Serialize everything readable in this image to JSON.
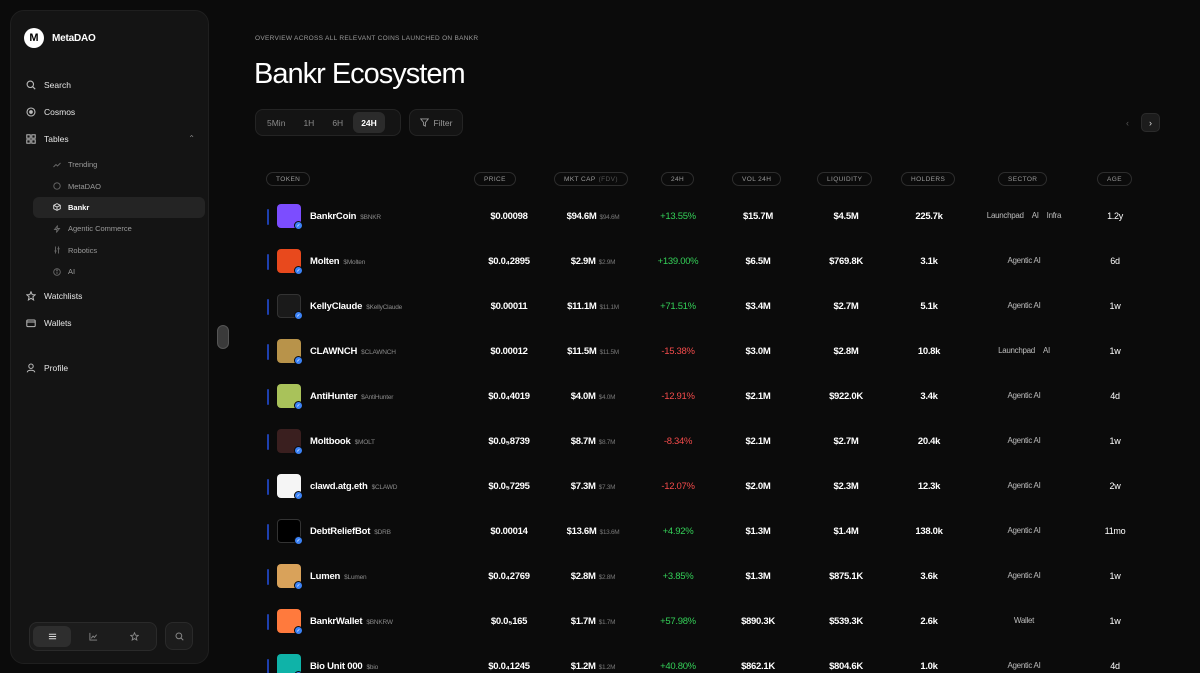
{
  "brand": {
    "logo_letter": "M",
    "name": "MetaDAO"
  },
  "nav": {
    "search": "Search",
    "cosmos": "Cosmos",
    "tables": "Tables",
    "sub": [
      "Trending",
      "MetaDAO",
      "Bankr",
      "Agentic Commerce",
      "Robotics",
      "AI"
    ],
    "watchlists": "Watchlists",
    "wallets": "Wallets",
    "profile": "Profile"
  },
  "page": {
    "eyebrow": "OVERVIEW ACROSS ALL RELEVANT COINS LAUNCHED ON BANKR",
    "title": "Bankr Ecosystem"
  },
  "timeframes": [
    "5Min",
    "1H",
    "6H",
    "24H"
  ],
  "active_timeframe": "24H",
  "filter_label": "Filter",
  "pager": {
    "prev": "‹",
    "next": "›"
  },
  "headers": {
    "token": "TOKEN",
    "price": "PRICE",
    "mcap": "MKT CAP",
    "mcap_sub": "(FDV)",
    "change": "24H",
    "vol": "VOL 24H",
    "liquidity": "LIQUIDITY",
    "holders": "HOLDERS",
    "sector": "SECTOR",
    "age": "AGE"
  },
  "rows": [
    {
      "name": "BankrCoin",
      "symbol": "$BNKR",
      "price": "$0.00098",
      "mcap": "$94.6M",
      "fdv": "$94.6M",
      "change": "+13.55%",
      "dir": "up",
      "vol": "$15.7M",
      "liq": "$4.5M",
      "holders": "225.7k",
      "sector": [
        "Launchpad",
        "AI",
        "Infra"
      ],
      "age": "1.2y",
      "logo_color": "#7c4dff"
    },
    {
      "name": "Molten",
      "symbol": "$Molten",
      "price": "$0.0₄2895",
      "mcap": "$2.9M",
      "fdv": "$2.9M",
      "change": "+139.00%",
      "dir": "up",
      "vol": "$6.5M",
      "liq": "$769.8K",
      "holders": "3.1k",
      "sector": [
        "Agentic AI"
      ],
      "age": "6d",
      "logo_color": "#e8491d"
    },
    {
      "name": "KellyClaude",
      "symbol": "$KellyClaude",
      "price": "$0.00011",
      "mcap": "$11.1M",
      "fdv": "$11.1M",
      "change": "+71.51%",
      "dir": "up",
      "vol": "$3.4M",
      "liq": "$2.7M",
      "holders": "5.1k",
      "sector": [
        "Agentic AI"
      ],
      "age": "1w",
      "logo_color": "#1a1a1a"
    },
    {
      "name": "CLAWNCH",
      "symbol": "$CLAWNCH",
      "price": "$0.00012",
      "mcap": "$11.5M",
      "fdv": "$11.5M",
      "change": "-15.38%",
      "dir": "down",
      "vol": "$3.0M",
      "liq": "$2.8M",
      "holders": "10.8k",
      "sector": [
        "Launchpad",
        "AI"
      ],
      "age": "1w",
      "logo_color": "#b8934a"
    },
    {
      "name": "AntiHunter",
      "symbol": "$AntiHunter",
      "price": "$0.0₄4019",
      "mcap": "$4.0M",
      "fdv": "$4.0M",
      "change": "-12.91%",
      "dir": "down",
      "vol": "$2.1M",
      "liq": "$922.0K",
      "holders": "3.4k",
      "sector": [
        "Agentic AI"
      ],
      "age": "4d",
      "logo_color": "#a9c25a"
    },
    {
      "name": "Moltbook",
      "symbol": "$MOLT",
      "price": "$0.0₅8739",
      "mcap": "$8.7M",
      "fdv": "$8.7M",
      "change": "-8.34%",
      "dir": "down",
      "vol": "$2.1M",
      "liq": "$2.7M",
      "holders": "20.4k",
      "sector": [
        "Agentic AI"
      ],
      "age": "1w",
      "logo_color": "#3a1f1f"
    },
    {
      "name": "clawd.atg.eth",
      "symbol": "$CLAWD",
      "price": "$0.0₅7295",
      "mcap": "$7.3M",
      "fdv": "$7.3M",
      "change": "-12.07%",
      "dir": "down",
      "vol": "$2.0M",
      "liq": "$2.3M",
      "holders": "12.3k",
      "sector": [
        "Agentic AI"
      ],
      "age": "2w",
      "logo_color": "#f5f5f5"
    },
    {
      "name": "DebtReliefBot",
      "symbol": "$DRB",
      "price": "$0.00014",
      "mcap": "$13.6M",
      "fdv": "$13.6M",
      "change": "+4.92%",
      "dir": "up",
      "vol": "$1.3M",
      "liq": "$1.4M",
      "holders": "138.0k",
      "sector": [
        "Agentic AI"
      ],
      "age": "11mo",
      "logo_color": "#000000"
    },
    {
      "name": "Lumen",
      "symbol": "$Lumen",
      "price": "$0.0₄2769",
      "mcap": "$2.8M",
      "fdv": "$2.8M",
      "change": "+3.85%",
      "dir": "up",
      "vol": "$1.3M",
      "liq": "$875.1K",
      "holders": "3.6k",
      "sector": [
        "Agentic AI"
      ],
      "age": "1w",
      "logo_color": "#d9a25a"
    },
    {
      "name": "BankrWallet",
      "symbol": "$BNKRW",
      "price": "$0.0₅165",
      "mcap": "$1.7M",
      "fdv": "$1.7M",
      "change": "+57.98%",
      "dir": "up",
      "vol": "$890.3K",
      "liq": "$539.3K",
      "holders": "2.6k",
      "sector": [
        "Wallet"
      ],
      "age": "1w",
      "logo_color": "#ff7a3d"
    },
    {
      "name": "Bio Unit 000",
      "symbol": "$bio",
      "price": "$0.0₄1245",
      "mcap": "$1.2M",
      "fdv": "$1.2M",
      "change": "+40.80%",
      "dir": "up",
      "vol": "$862.1K",
      "liq": "$804.6K",
      "holders": "1.0k",
      "sector": [
        "Agentic AI"
      ],
      "age": "4d",
      "logo_color": "#0fb3a8"
    }
  ]
}
